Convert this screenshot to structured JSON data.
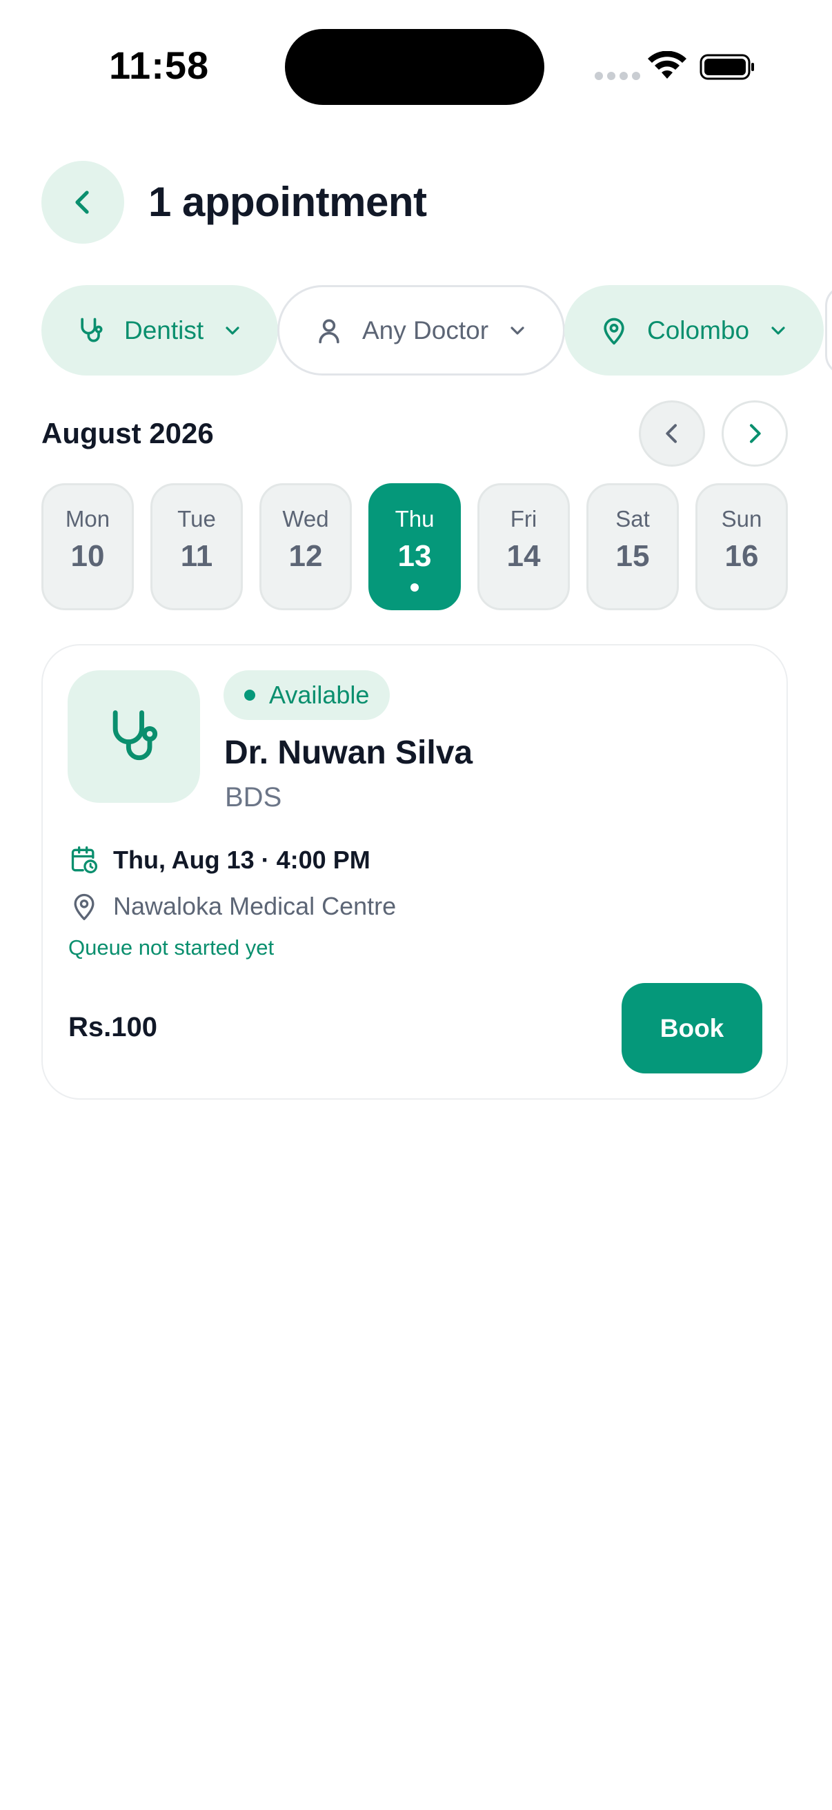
{
  "status_bar": {
    "time": "11:58"
  },
  "header": {
    "title": "1 appointment",
    "back_icon": "chevron-left-icon"
  },
  "filters": [
    {
      "label": "Dentist",
      "icon": "stethoscope-icon",
      "style": "filled"
    },
    {
      "label": "Any Doctor",
      "icon": "user-icon",
      "style": "outline"
    },
    {
      "label": "Colombo",
      "icon": "map-pin-icon",
      "style": "filled"
    }
  ],
  "calendar": {
    "month": "August 2026",
    "days": [
      {
        "name": "Mon",
        "num": "10",
        "selected": false
      },
      {
        "name": "Tue",
        "num": "11",
        "selected": false
      },
      {
        "name": "Wed",
        "num": "12",
        "selected": false
      },
      {
        "name": "Thu",
        "num": "13",
        "selected": true
      },
      {
        "name": "Fri",
        "num": "14",
        "selected": false
      },
      {
        "name": "Sat",
        "num": "15",
        "selected": false
      },
      {
        "name": "Sun",
        "num": "16",
        "selected": false
      }
    ]
  },
  "appointment": {
    "status": "Available",
    "doctor_name": "Dr. Nuwan Silva",
    "qualification": "BDS",
    "datetime": "Thu, Aug 13 · 4:00 PM",
    "location": "Nawaloka Medical Centre",
    "queue_status": "Queue not started yet",
    "price": "Rs.100",
    "book_label": "Book"
  },
  "colors": {
    "accent": "#05987a",
    "accent_light": "#e3f3ec",
    "text_dark": "#111827",
    "text_muted": "#5c6575"
  }
}
